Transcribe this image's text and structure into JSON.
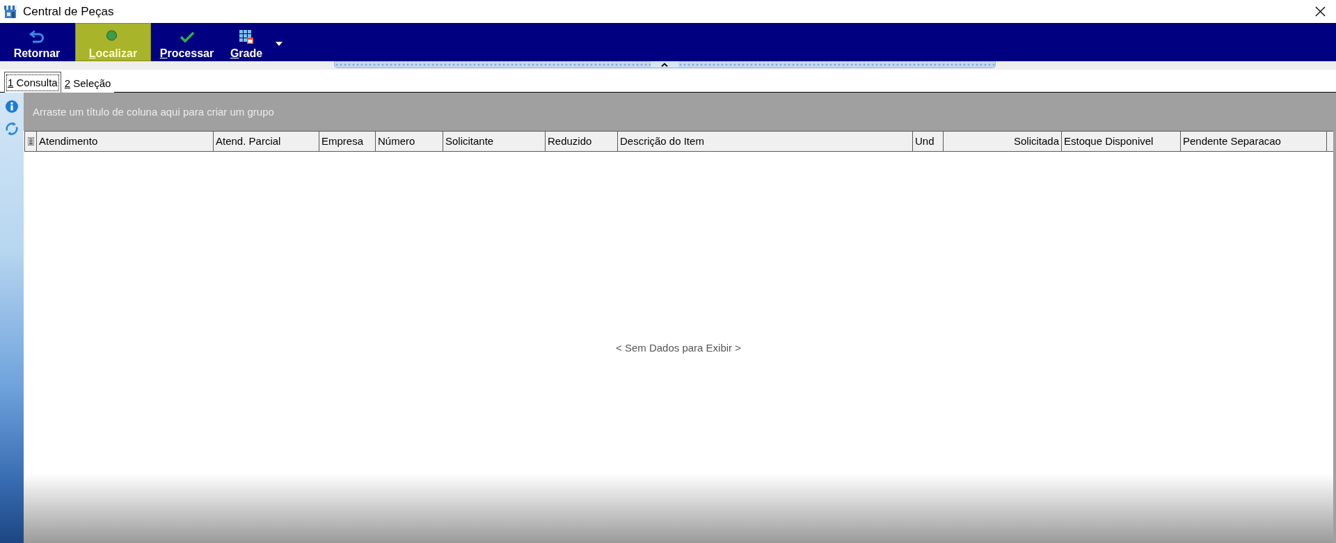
{
  "window": {
    "title": "Central de Peças"
  },
  "toolbar": {
    "buttons": [
      {
        "label": "Retornar",
        "access_key": false,
        "highlighted": false
      },
      {
        "label": "Localizar",
        "access_key": true,
        "highlighted": true
      },
      {
        "label": "Processar",
        "access_key": true,
        "highlighted": false
      },
      {
        "label": "Grade",
        "access_key": true,
        "highlighted": false
      }
    ]
  },
  "tabs": [
    {
      "label": "1 Consulta",
      "access_key": true,
      "selected": true
    },
    {
      "label": "2 Seleção",
      "access_key": true,
      "selected": false
    }
  ],
  "grid": {
    "group_panel_hint": "Arraste um título de coluna aqui para criar um grupo",
    "columns": [
      {
        "label": "Atendimento",
        "kind": "text"
      },
      {
        "label": "Atend. Parcial",
        "kind": "text"
      },
      {
        "label": "Empresa",
        "kind": "text"
      },
      {
        "label": "Número",
        "kind": "text"
      },
      {
        "label": "Solicitante",
        "kind": "text"
      },
      {
        "label": "Reduzido",
        "kind": "text"
      },
      {
        "label": "Descrição do Item",
        "kind": "text"
      },
      {
        "label": "Und",
        "kind": "text"
      },
      {
        "label": "Solicitada",
        "kind": "numeric"
      },
      {
        "label": "Estoque Disponivel",
        "kind": "text"
      },
      {
        "label": "Pendente Separacao",
        "kind": "text"
      }
    ],
    "empty_message": "< Sem Dados para Exibir >"
  }
}
